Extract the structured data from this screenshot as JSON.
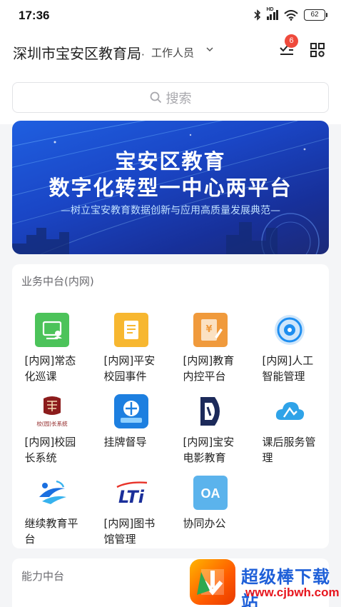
{
  "status_bar": {
    "time": "17:36",
    "network": "HD",
    "battery": "62"
  },
  "header": {
    "org": "深圳市宝安区教育局",
    "separator": "·",
    "role": "工作人员",
    "todo_badge": "6"
  },
  "search": {
    "placeholder": "搜索"
  },
  "banner": {
    "line1": "宝安区教育",
    "line2": "数字化转型一中心两平台",
    "subtitle": "—树立宝安教育数据创新与应用高质量发展典范—"
  },
  "business_section": {
    "title": "业务中台(内网)",
    "apps": [
      {
        "label": "[内网]常态化巡课",
        "icon": "monitor-user-icon",
        "color": "#4cc35a"
      },
      {
        "label": "[内网]平安校园事件",
        "icon": "document-icon",
        "color": "#f7b730"
      },
      {
        "label": "[内网]教育内控平台",
        "icon": "yen-doc-icon",
        "color": "#f09a3c"
      },
      {
        "label": "[内网]人工智能管理",
        "icon": "ai-eye-icon",
        "color": "#1e8ef0"
      },
      {
        "label": "[内网]校园长系统",
        "icon": "school-emblem-icon",
        "color": "#8c1c1c",
        "logo_text": "校(园)长系统"
      },
      {
        "label": "挂牌督导",
        "icon": "supervision-icon",
        "color": "#1d7fe0"
      },
      {
        "label": "[内网]宝安电影教育",
        "icon": "film-logo-icon",
        "color": "#1c2a5a"
      },
      {
        "label": "课后服务管理",
        "icon": "cloud-icon",
        "color": "#2fa3e8"
      },
      {
        "label": "继续教育平台",
        "icon": "swirl-logo-icon",
        "color": "#1a6fe0"
      },
      {
        "label": "[内网]图书馆管理",
        "icon": "lti-logo-icon",
        "color": "#1b2f9a",
        "logo_text": "LTi"
      },
      {
        "label": "协同办公",
        "icon": "oa-icon",
        "color": "#5bb3ec",
        "logo_text": "OA"
      }
    ]
  },
  "ability_section": {
    "title": "能力中台"
  },
  "watermark": {
    "title": "超级棒下载站",
    "url": "www.cjbwh.com"
  }
}
